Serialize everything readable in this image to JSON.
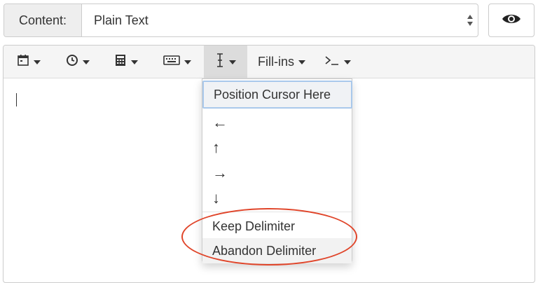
{
  "content_label": "Content:",
  "content_value": "Plain Text",
  "toolbar": {
    "fillins_label": "Fill-ins",
    "icons": [
      "calendar-icon",
      "clock-icon",
      "calculator-icon",
      "keyboard-icon",
      "text-cursor-icon",
      "terminal-icon"
    ]
  },
  "dropdown": {
    "position_cursor": "Position Cursor Here",
    "left": "←",
    "up": "↑",
    "right": "→",
    "down": "↓",
    "keep_delimiter": "Keep Delimiter",
    "abandon_delimiter": "Abandon Delimiter"
  },
  "colors": {
    "highlight": "#e0452a",
    "focus_border": "#a9c8eb",
    "toolbar_bg": "#f5f5f5",
    "active_bg": "#dcdcdc"
  }
}
